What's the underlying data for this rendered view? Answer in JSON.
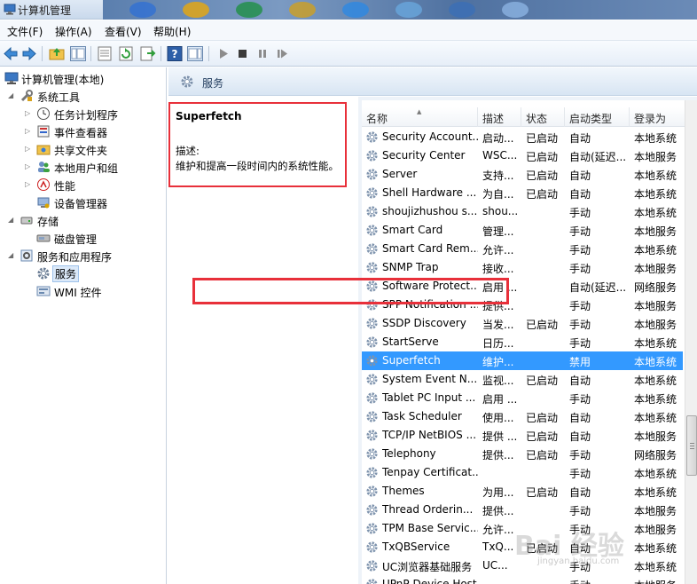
{
  "window": {
    "title": "计算机管理"
  },
  "menu": [
    {
      "label": "文件(F)"
    },
    {
      "label": "操作(A)"
    },
    {
      "label": "查看(V)"
    },
    {
      "label": "帮助(H)"
    }
  ],
  "tree": {
    "root": "计算机管理(本地)",
    "system_tools": "系统工具",
    "task_scheduler": "任务计划程序",
    "event_viewer": "事件查看器",
    "shared_folders": "共享文件夹",
    "local_users": "本地用户和组",
    "performance": "性能",
    "device_manager": "设备管理器",
    "storage": "存储",
    "disk_management": "磁盘管理",
    "services_apps": "服务和应用程序",
    "services": "服务",
    "wmi": "WMI 控件"
  },
  "panel": {
    "title": "服务"
  },
  "description": {
    "name": "Superfetch",
    "label": "描述:",
    "text": "维护和提高一段时间内的系统性能。"
  },
  "columns": [
    "名称",
    "描述",
    "状态",
    "启动类型",
    "登录为"
  ],
  "services": [
    [
      "Security Account...",
      "启动...",
      "已启动",
      "自动",
      "本地系统"
    ],
    [
      "Security Center",
      "WSC...",
      "已启动",
      "自动(延迟...",
      "本地服务"
    ],
    [
      "Server",
      "支持...",
      "已启动",
      "自动",
      "本地系统"
    ],
    [
      "Shell Hardware ...",
      "为自...",
      "已启动",
      "自动",
      "本地系统"
    ],
    [
      "shoujizhushou s...",
      "shou...",
      "",
      "手动",
      "本地系统"
    ],
    [
      "Smart Card",
      "管理...",
      "",
      "手动",
      "本地服务"
    ],
    [
      "Smart Card Rem...",
      "允许...",
      "",
      "手动",
      "本地系统"
    ],
    [
      "SNMP Trap",
      "接收...",
      "",
      "手动",
      "本地服务"
    ],
    [
      "Software Protect...",
      "启用 ...",
      "",
      "自动(延迟...",
      "网络服务"
    ],
    [
      "SPP Notification ...",
      "提供...",
      "",
      "手动",
      "本地服务"
    ],
    [
      "SSDP Discovery",
      "当发...",
      "已启动",
      "手动",
      "本地服务"
    ],
    [
      "StartServe",
      "日历...",
      "",
      "手动",
      "本地系统"
    ],
    [
      "Superfetch",
      "维护...",
      "",
      "禁用",
      "本地系统"
    ],
    [
      "System Event N...",
      "监视...",
      "已启动",
      "自动",
      "本地系统"
    ],
    [
      "Tablet PC Input ...",
      "启用 ...",
      "",
      "手动",
      "本地系统"
    ],
    [
      "Task Scheduler",
      "使用...",
      "已启动",
      "自动",
      "本地系统"
    ],
    [
      "TCP/IP NetBIOS ...",
      "提供 ...",
      "已启动",
      "自动",
      "本地服务"
    ],
    [
      "Telephony",
      "提供...",
      "已启动",
      "手动",
      "网络服务"
    ],
    [
      "Tenpay Certificat...",
      "",
      "",
      "手动",
      "本地系统"
    ],
    [
      "Themes",
      "为用...",
      "已启动",
      "自动",
      "本地系统"
    ],
    [
      "Thread Orderin...",
      "提供...",
      "",
      "手动",
      "本地服务"
    ],
    [
      "TPM Base Servic...",
      "允许...",
      "",
      "手动",
      "本地服务"
    ],
    [
      "TxQBService",
      "TxQ...",
      "已启动",
      "自动",
      "本地系统"
    ],
    [
      "UC浏览器基础服务",
      "UC...",
      "",
      "手动",
      "本地系统"
    ],
    [
      "UPnP Device Host",
      "",
      "",
      "手动",
      "本地服务"
    ]
  ],
  "selected_row": 12,
  "watermark": {
    "main": "Bai 经验",
    "sub": "jingyan.baidu.com"
  },
  "colors": {
    "selection": "#3399ff",
    "annotation": "#e8303a"
  }
}
